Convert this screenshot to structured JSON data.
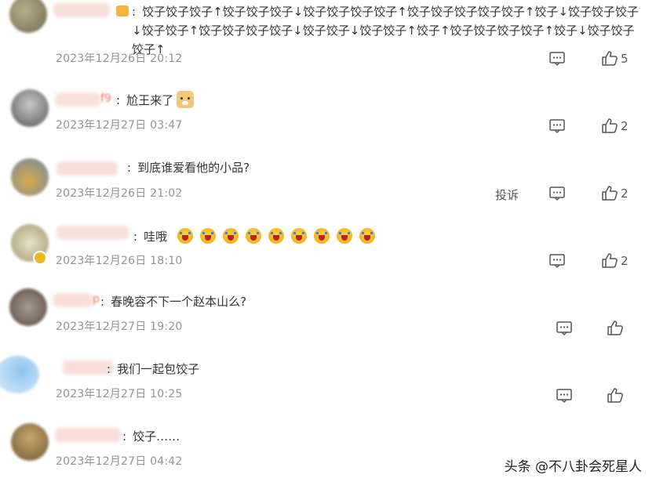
{
  "comments": [
    {
      "name_suffix": "",
      "text": "饺子饺子饺子↑饺子饺子饺子↓饺子饺子饺子饺子↑饺子饺子饺子饺子饺子↑饺子↓饺子饺子饺子↓饺子饺子↑饺子饺子饺子饺子↓饺子饺子↓饺子饺子↑饺子↑饺子饺子饺子饺子↑饺子↓饺子饺子饺子↑",
      "time": "2023年12月26日 20:12",
      "likes": "5",
      "report": ""
    },
    {
      "name_suffix": "f9",
      "text": "尬王来了",
      "time": "2023年12月27日 03:47",
      "likes": "2",
      "report": ""
    },
    {
      "name_suffix": "",
      "text": "到底谁爱看他的小品?",
      "time": "2023年12月26日 21:02",
      "likes": "2",
      "report": "投诉"
    },
    {
      "name_suffix": "",
      "text": "哇哦",
      "time": "2023年12月26日 18:10",
      "likes": "2",
      "report": ""
    },
    {
      "name_suffix": "p",
      "text": "春晚容不下一个赵本山么?",
      "time": "2023年12月27日 19:20",
      "likes": "",
      "report": ""
    },
    {
      "name_suffix": "",
      "text": "我们一起包饺子",
      "time": "2023年12月27日 10:25",
      "likes": "",
      "report": ""
    },
    {
      "name_suffix": "",
      "text": "饺子……",
      "time": "2023年12月27日 04:42",
      "likes": "",
      "report": ""
    }
  ],
  "colon": ":",
  "watermark": "头条 @不八卦会死星人",
  "icons": {
    "comment": "comment-icon",
    "like": "thumbs-up-icon",
    "reaction": "crying-emoji-icon"
  },
  "colors": {
    "time": "#939393",
    "text": "#333333",
    "name": "#eb7350"
  }
}
